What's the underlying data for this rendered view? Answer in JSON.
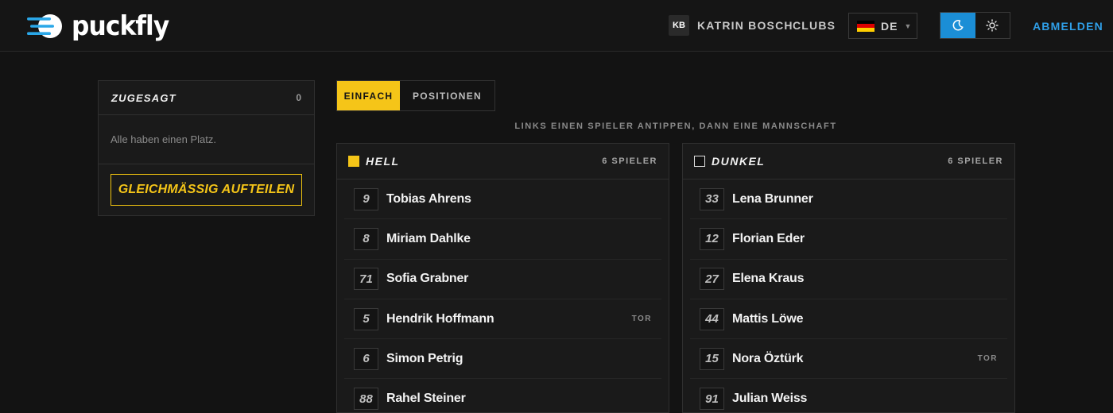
{
  "header": {
    "brand": "puckfly",
    "user_initials": "KB",
    "user_name": "KATRIN BOSCH",
    "nav_clubs": "CLUBS",
    "language": "DE",
    "logout": "ABMELDEN",
    "accent_color": "#1b8ed6"
  },
  "sidebar": {
    "title": "ZUGESAGT",
    "count": "0",
    "empty_text": "Alle haben einen Platz.",
    "split_button": "Gleichmässig aufteilen"
  },
  "mode_tabs": [
    {
      "label": "EINFACH",
      "active": true
    },
    {
      "label": "POSITIONEN",
      "active": false
    }
  ],
  "hint": "LINKS EINEN SPIELER ANTIPPEN, DANN EINE MANNSCHAFT",
  "teams": [
    {
      "name": "HELL",
      "count_label": "6 SPIELER",
      "swatch_color": "#f5c518",
      "players": [
        {
          "number": "9",
          "name": "Tobias Ahrens",
          "position": ""
        },
        {
          "number": "8",
          "name": "Miriam Dahlke",
          "position": ""
        },
        {
          "number": "71",
          "name": "Sofia Grabner",
          "position": ""
        },
        {
          "number": "5",
          "name": "Hendrik Hoffmann",
          "position": "TOR"
        },
        {
          "number": "6",
          "name": "Simon Petrig",
          "position": ""
        },
        {
          "number": "88",
          "name": "Rahel Steiner",
          "position": ""
        }
      ]
    },
    {
      "name": "DUNKEL",
      "count_label": "6 SPIELER",
      "swatch_color": "#111111",
      "players": [
        {
          "number": "33",
          "name": "Lena Brunner",
          "position": ""
        },
        {
          "number": "12",
          "name": "Florian Eder",
          "position": ""
        },
        {
          "number": "27",
          "name": "Elena Kraus",
          "position": ""
        },
        {
          "number": "44",
          "name": "Mattis Löwe",
          "position": ""
        },
        {
          "number": "15",
          "name": "Nora Öztürk",
          "position": "TOR"
        },
        {
          "number": "91",
          "name": "Julian Weiss",
          "position": ""
        }
      ]
    }
  ]
}
